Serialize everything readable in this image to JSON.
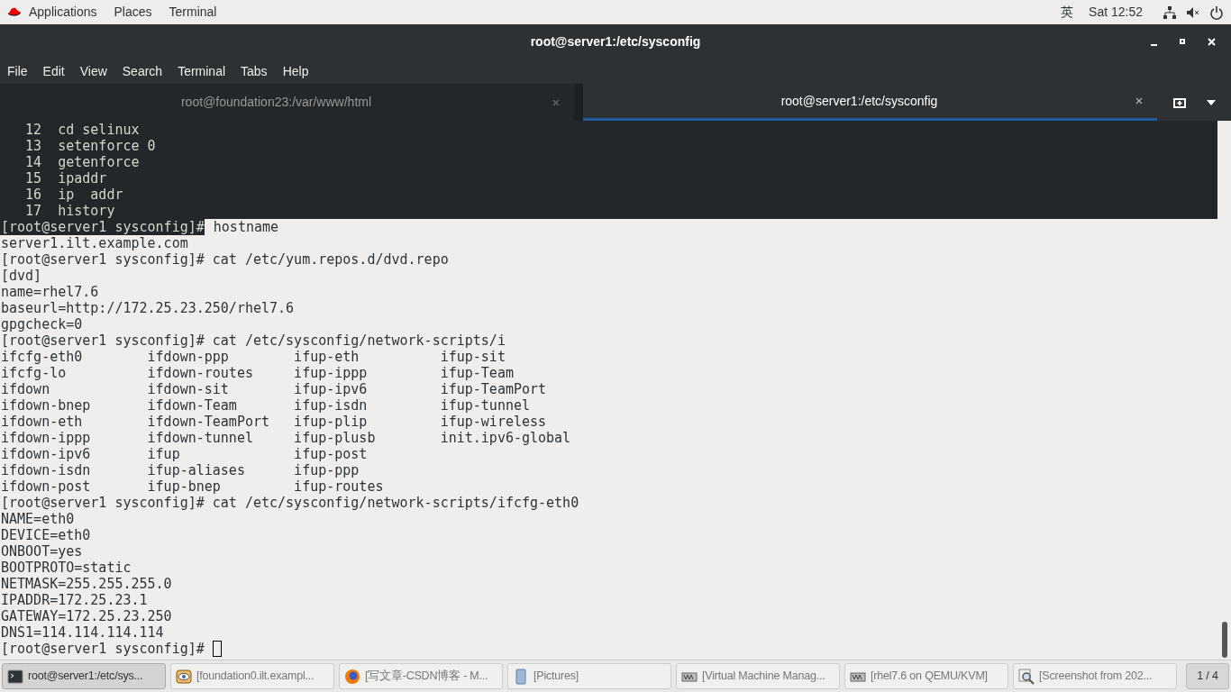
{
  "top_bar": {
    "menus": [
      "Applications",
      "Places",
      "Terminal"
    ],
    "input_method": "英",
    "clock": "Sat 12:52"
  },
  "window": {
    "title": "root@server1:/etc/sysconfig"
  },
  "menu_bar": [
    "File",
    "Edit",
    "View",
    "Search",
    "Terminal",
    "Tabs",
    "Help"
  ],
  "tabs": [
    {
      "label": "root@foundation23:/var/www/html",
      "selected": false
    },
    {
      "label": "root@server1:/etc/sysconfig",
      "selected": true
    }
  ],
  "terminal": {
    "lines": [
      {
        "kind": "plain",
        "text": "   12  cd selinux",
        "highlighted": false
      },
      {
        "kind": "plain",
        "text": "   13  setenforce 0",
        "highlighted": false
      },
      {
        "kind": "plain",
        "text": "   14  getenforce",
        "highlighted": false
      },
      {
        "kind": "plain",
        "text": "   15  ipaddr",
        "highlighted": false
      },
      {
        "kind": "plain",
        "text": "   16  ip  addr",
        "highlighted": false
      },
      {
        "kind": "plain",
        "text": "   17  history",
        "highlighted": false
      },
      {
        "kind": "mixed",
        "segments": [
          {
            "text": "[root@server1 sysconfig]#",
            "highlighted": false
          },
          {
            "text": " hostname",
            "highlighted": true
          }
        ]
      },
      {
        "kind": "plain",
        "text": "server1.ilt.example.com",
        "highlighted": true
      },
      {
        "kind": "plain",
        "text": "[root@server1 sysconfig]# cat /etc/yum.repos.d/dvd.repo",
        "highlighted": true
      },
      {
        "kind": "plain",
        "text": "[dvd]",
        "highlighted": true
      },
      {
        "kind": "plain",
        "text": "name=rhel7.6",
        "highlighted": true
      },
      {
        "kind": "plain",
        "text": "baseurl=http://172.25.23.250/rhel7.6",
        "highlighted": true
      },
      {
        "kind": "plain",
        "text": "gpgcheck=0",
        "highlighted": true
      },
      {
        "kind": "plain",
        "text": "[root@server1 sysconfig]# cat /etc/sysconfig/network-scripts/i",
        "highlighted": true
      },
      {
        "kind": "plain",
        "text": "ifcfg-eth0        ifdown-ppp        ifup-eth          ifup-sit",
        "highlighted": true
      },
      {
        "kind": "plain",
        "text": "ifcfg-lo          ifdown-routes     ifup-ippp         ifup-Team",
        "highlighted": true
      },
      {
        "kind": "plain",
        "text": "ifdown            ifdown-sit        ifup-ipv6         ifup-TeamPort",
        "highlighted": true
      },
      {
        "kind": "plain",
        "text": "ifdown-bnep       ifdown-Team       ifup-isdn         ifup-tunnel",
        "highlighted": true
      },
      {
        "kind": "plain",
        "text": "ifdown-eth        ifdown-TeamPort   ifup-plip         ifup-wireless",
        "highlighted": true
      },
      {
        "kind": "plain",
        "text": "ifdown-ippp       ifdown-tunnel     ifup-plusb        init.ipv6-global",
        "highlighted": true
      },
      {
        "kind": "plain",
        "text": "ifdown-ipv6       ifup              ifup-post",
        "highlighted": true
      },
      {
        "kind": "plain",
        "text": "ifdown-isdn       ifup-aliases      ifup-ppp",
        "highlighted": true
      },
      {
        "kind": "plain",
        "text": "ifdown-post       ifup-bnep         ifup-routes",
        "highlighted": true
      },
      {
        "kind": "plain",
        "text": "[root@server1 sysconfig]# cat /etc/sysconfig/network-scripts/ifcfg-eth0",
        "highlighted": true
      },
      {
        "kind": "plain",
        "text": "NAME=eth0",
        "highlighted": true
      },
      {
        "kind": "plain",
        "text": "DEVICE=eth0",
        "highlighted": true
      },
      {
        "kind": "plain",
        "text": "ONBOOT=yes",
        "highlighted": true
      },
      {
        "kind": "plain",
        "text": "BOOTPROTO=static",
        "highlighted": true
      },
      {
        "kind": "plain",
        "text": "NETMASK=255.255.255.0",
        "highlighted": true
      },
      {
        "kind": "plain",
        "text": "IPADDR=172.25.23.1",
        "highlighted": true
      },
      {
        "kind": "plain",
        "text": "GATEWAY=172.25.23.250",
        "highlighted": true
      },
      {
        "kind": "plain",
        "text": "DNS1=114.114.114.114",
        "highlighted": true
      },
      {
        "kind": "prompt",
        "text": "[root@server1 sysconfig]# ",
        "highlighted": true
      }
    ]
  },
  "taskbar": {
    "items": [
      {
        "kind": "terminal",
        "label": "root@server1:/etc/sys...",
        "selected": true
      },
      {
        "kind": "viewer",
        "label": "[foundation0.ilt.exampl...",
        "selected": false
      },
      {
        "kind": "browser",
        "label": "[写文章-CSDN博客 - M...",
        "selected": false
      },
      {
        "kind": "files",
        "label": "[Pictures]",
        "selected": false
      },
      {
        "kind": "vm",
        "label": "[Virtual Machine Manag...",
        "selected": false
      },
      {
        "kind": "vm",
        "label": "[rhel7.6 on QEMU/KVM]",
        "selected": false
      },
      {
        "kind": "screenshot",
        "label": "[Screenshot from 202...",
        "selected": false
      }
    ],
    "workspace": "1 / 4"
  }
}
